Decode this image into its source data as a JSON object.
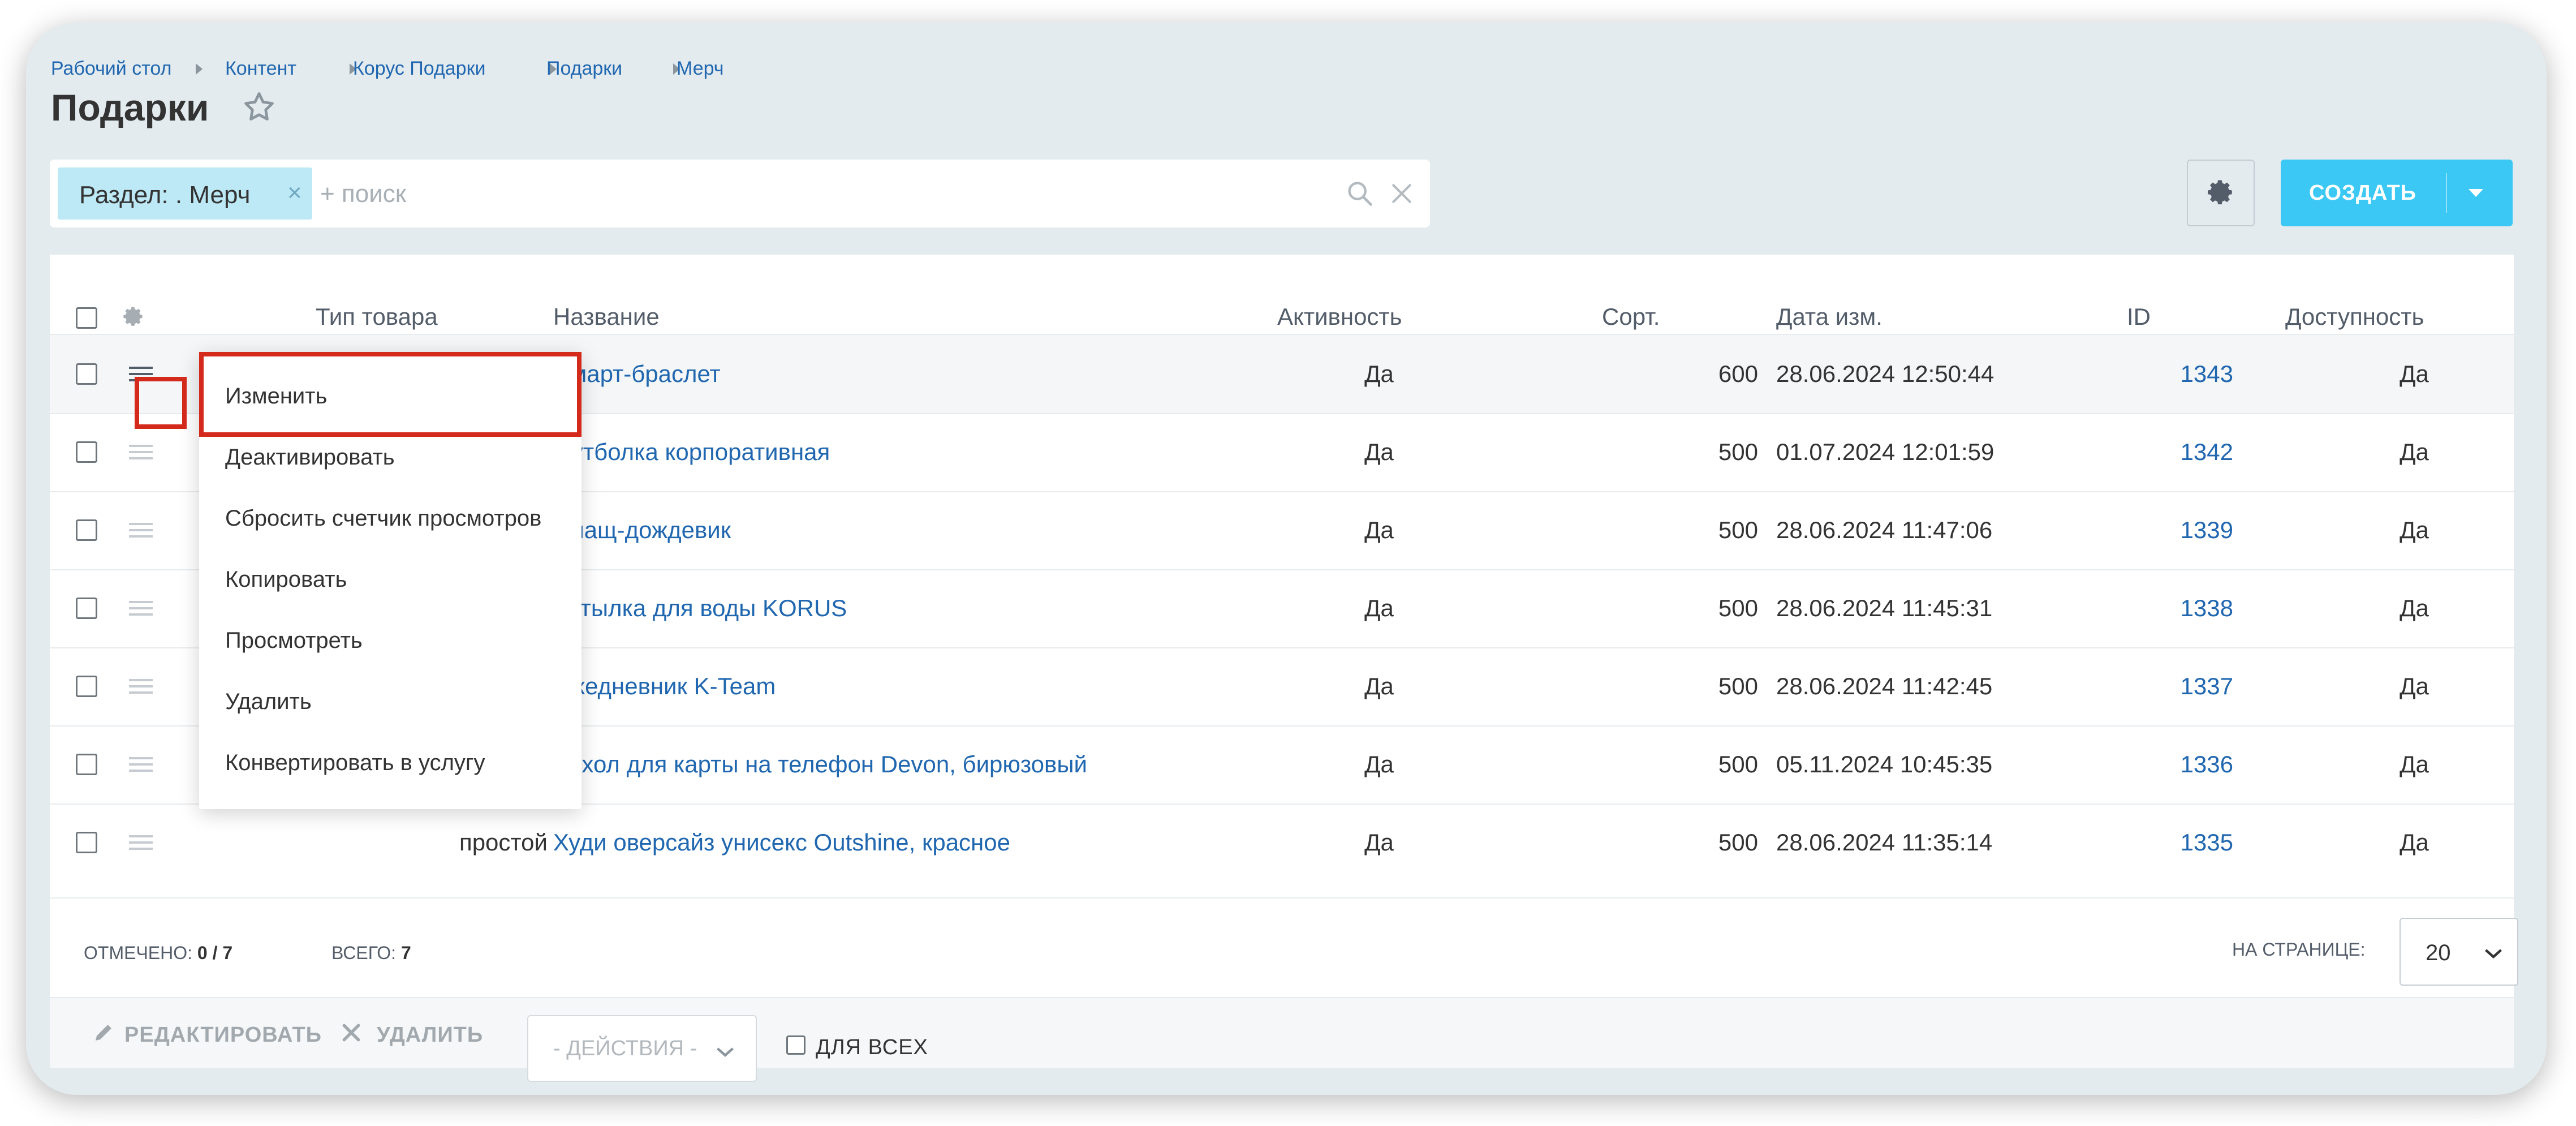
{
  "breadcrumbs": [
    "Рабочий стол",
    "Контент",
    "Корус Подарки",
    "Подарки",
    "Мерч"
  ],
  "page_title": "Подарки",
  "filter": {
    "chip_label": "Раздел: . Мерч",
    "chip_remove": "×",
    "search_placeholder": "+ поиск"
  },
  "toolbar": {
    "create_label": "СОЗДАТЬ"
  },
  "table": {
    "columns": [
      "Тип товара",
      "Название",
      "Активность",
      "Сорт.",
      "Дата изм.",
      "ID",
      "Доступность"
    ],
    "rows": [
      {
        "type": "",
        "name": "Смарт-браслет",
        "active": "Да",
        "sort": "600",
        "date": "28.06.2024 12:50:44",
        "id": "1343",
        "available": "Да"
      },
      {
        "type": "",
        "name": "Футболка корпоративная",
        "active": "Да",
        "sort": "500",
        "date": "01.07.2024 12:01:59",
        "id": "1342",
        "available": "Да"
      },
      {
        "type": "",
        "name": "Плащ-дождевик",
        "active": "Да",
        "sort": "500",
        "date": "28.06.2024 11:47:06",
        "id": "1339",
        "available": "Да"
      },
      {
        "type": "",
        "name": "Бутылка для воды KORUS",
        "active": "Да",
        "sort": "500",
        "date": "28.06.2024 11:45:31",
        "id": "1338",
        "available": "Да"
      },
      {
        "type": "",
        "name": "Ежедневник K-Team",
        "active": "Да",
        "sort": "500",
        "date": "28.06.2024 11:42:45",
        "id": "1337",
        "available": "Да"
      },
      {
        "type": "",
        "name": "Чехол для карты на телефон Devon, бирюзовый",
        "active": "Да",
        "sort": "500",
        "date": "05.11.2024 10:45:35",
        "id": "1336",
        "available": "Да"
      },
      {
        "type": "простой",
        "name": "Худи оверсайз унисекс Outshine, красное",
        "active": "Да",
        "sort": "500",
        "date": "28.06.2024 11:35:14",
        "id": "1335",
        "available": "Да"
      }
    ]
  },
  "context_menu": {
    "items": [
      "Изменить",
      "Деактивировать",
      "Сбросить счетчик просмотров",
      "Копировать",
      "Просмотреть",
      "Удалить",
      "Конвертировать в услугу"
    ]
  },
  "footer": {
    "selected_label": "ОТМЕЧЕНО:",
    "selected_value": "0 / 7",
    "total_label": "ВСЕГО:",
    "total_value": "7",
    "per_page_label": "НА СТРАНИЦЕ:",
    "per_page_value": "20"
  },
  "actions": {
    "edit_label": "РЕДАКТИРОВАТЬ",
    "delete_label": "УДАЛИТЬ",
    "actions_select": "- ДЕЙСТВИЯ -",
    "for_all_label": "ДЛЯ ВСЕХ"
  },
  "colors": {
    "accent": "#3bc8f5",
    "link": "#2067b0",
    "highlight": "#d42a1c",
    "chip": "#bde8f6"
  }
}
